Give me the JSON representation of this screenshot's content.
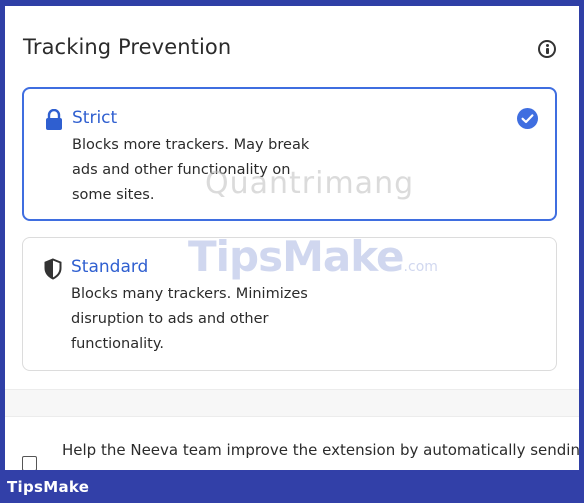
{
  "panel": {
    "title": "Tracking Prevention",
    "info_icon": "info-icon"
  },
  "options": [
    {
      "id": "strict",
      "label": "Strict",
      "icon": "lock-icon",
      "selected": true,
      "description": "Blocks more trackers. May break ads and other functionality on some sites."
    },
    {
      "id": "standard",
      "label": "Standard",
      "icon": "shield-icon",
      "selected": false,
      "description": "Blocks many trackers. Minimizes disruption to ads and other functionality."
    }
  ],
  "consent": {
    "text": "Help the Neeva team improve the extension by automatically sending",
    "checked": false
  },
  "watermarks": {
    "top": "Quantrimang",
    "middle": "TipsMake",
    "middle_suffix": ".com"
  },
  "footer": {
    "brand": "TipsMake"
  },
  "colors": {
    "accent": "#3f6ee0",
    "title_blue": "#2f5fd0",
    "frame": "#2f3fa6",
    "footer": "#3240a8"
  }
}
